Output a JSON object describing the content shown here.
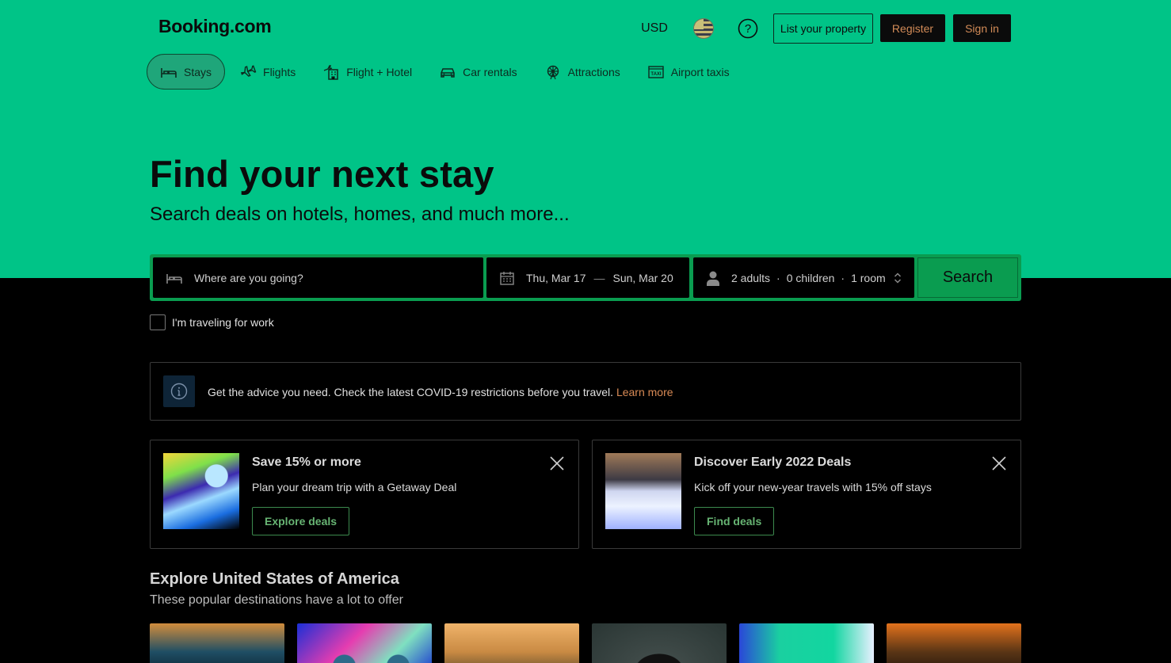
{
  "header": {
    "logo": "Booking.com",
    "currency": "USD",
    "list_property": "List your property",
    "register": "Register",
    "sign_in": "Sign in"
  },
  "nav": {
    "stays": "Stays",
    "flights": "Flights",
    "flight_hotel": "Flight + Hotel",
    "car_rentals": "Car rentals",
    "attractions": "Attractions",
    "airport_taxis": "Airport taxis"
  },
  "hero": {
    "title": "Find your next stay",
    "subtitle": "Search deals on hotels, homes, and much more..."
  },
  "search": {
    "destination_placeholder": "Where are you going?",
    "checkin": "Thu, Mar 17",
    "date_separator": "—",
    "checkout": "Sun, Mar 20",
    "adults": "2 adults",
    "children": "0 children",
    "rooms": "1 room",
    "dot": "·",
    "button": "Search",
    "work_label": "I'm traveling for work"
  },
  "alert": {
    "text": "Get the advice you need. Check the latest COVID-19 restrictions before you travel.",
    "link": "Learn more"
  },
  "promos": [
    {
      "title": "Save 15% or more",
      "subtitle": "Plan your dream trip with a Getaway Deal",
      "button": "Explore deals"
    },
    {
      "title": "Discover Early 2022 Deals",
      "subtitle": "Kick off your new-year travels with 15% off stays",
      "button": "Find deals"
    }
  ],
  "explore": {
    "title": "Explore United States of America",
    "subtitle": "These popular destinations have a lot to offer"
  },
  "colors": {
    "hero_bg": "#00c487",
    "page_bg": "#000000",
    "search_accent": "#0a9c50",
    "link": "#d88a55"
  }
}
